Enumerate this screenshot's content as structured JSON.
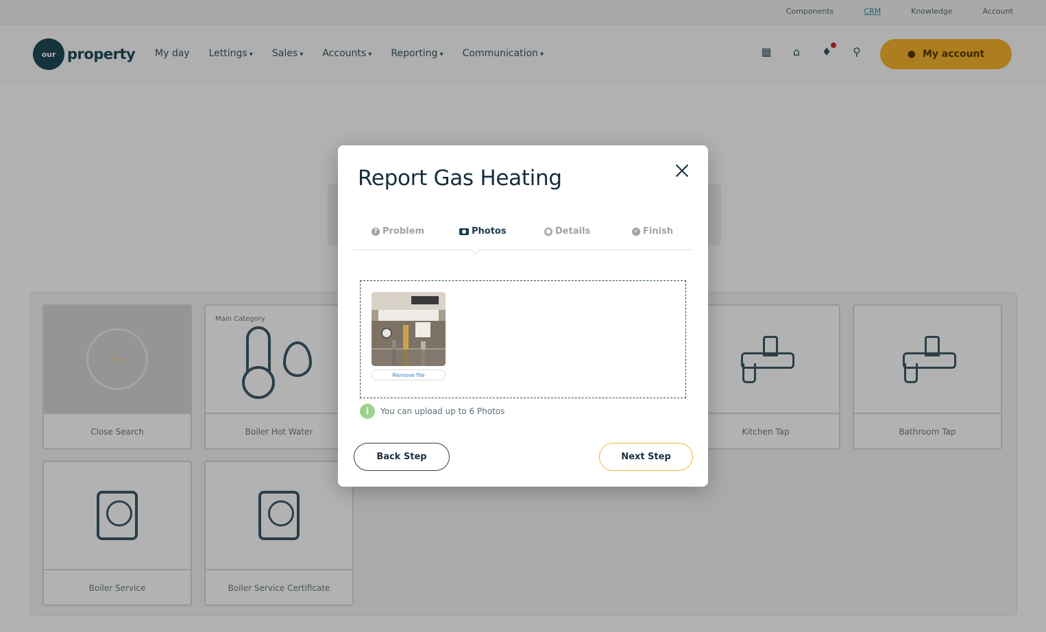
{
  "topbar": {
    "links": [
      "Components",
      "CRM",
      "Knowledge",
      "Account"
    ]
  },
  "nav": {
    "logo_mark": "our",
    "logo_word": "property",
    "menu": [
      "My day",
      "Lettings",
      "Sales",
      "Accounts",
      "Reporting",
      "Communication"
    ],
    "account_button": "My account"
  },
  "tiles": [
    {
      "caption": "Close Search"
    },
    {
      "caption": "Boiler Hot Water",
      "badge": "Main Category"
    },
    {
      "caption": "Kitchen Tap"
    },
    {
      "caption": "Bathroom Tap"
    },
    {
      "caption": "Boiler Service"
    },
    {
      "caption": "Boiler Service Certificate"
    }
  ],
  "modal": {
    "title": "Report Gas Heating",
    "steps": [
      {
        "label": "Problem",
        "icon": "question-circle-icon",
        "active": false
      },
      {
        "label": "Photos",
        "icon": "camera-icon",
        "active": true
      },
      {
        "label": "Details",
        "icon": "user-circle-icon",
        "active": false
      },
      {
        "label": "Finish",
        "icon": "check-circle-icon",
        "active": false
      }
    ],
    "remove_file_label": "Remove file",
    "upload_hint": "You can upload up to 6 Photos",
    "back_button": "Back Step",
    "next_button": "Next Step"
  },
  "colors": {
    "brand_dark": "#142d3c",
    "accent_yellow": "#f6b52d",
    "next_border": "#f0b53a",
    "info_green": "#9bd38e",
    "link_blue": "#3a84c7"
  }
}
